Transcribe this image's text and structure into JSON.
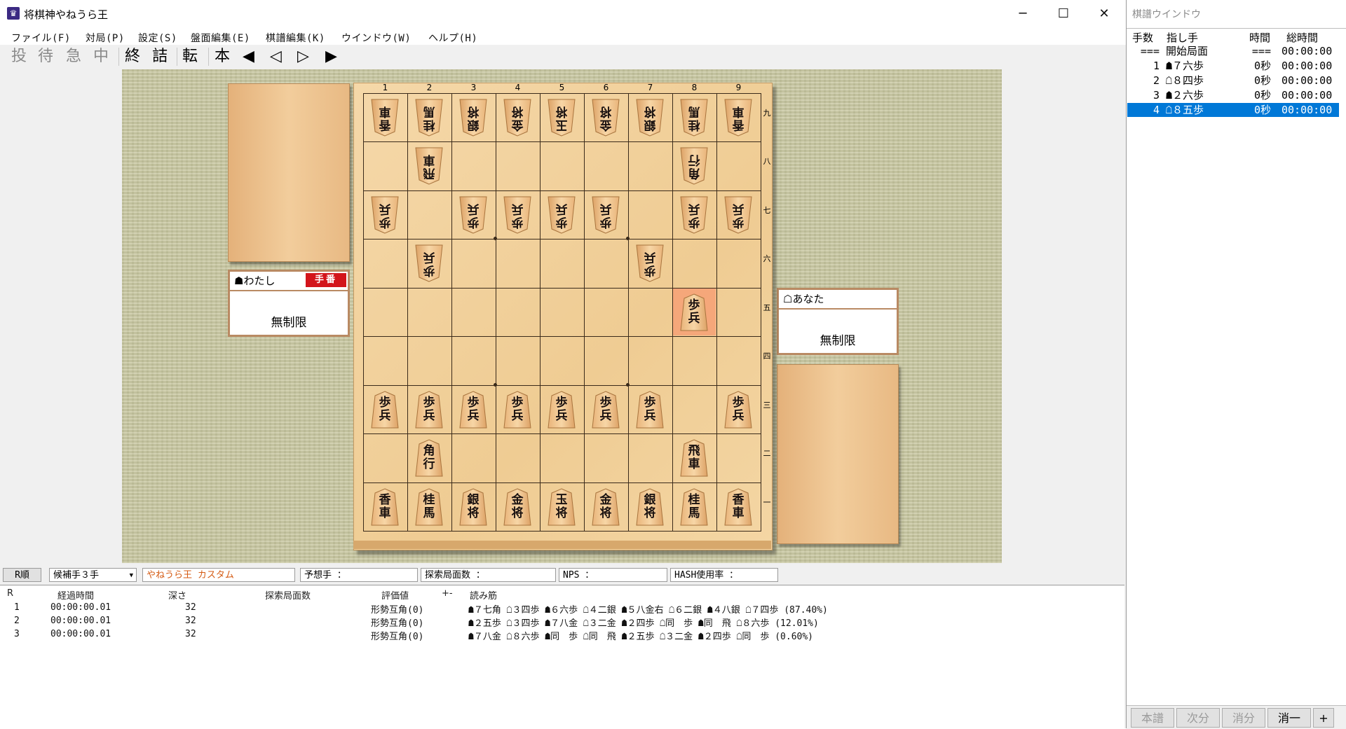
{
  "window": {
    "title": "将棋神やねうら王",
    "app_icon": "crown-icon",
    "minimize": "─",
    "maximize": "☐",
    "close": "✕"
  },
  "menu": [
    "ファイル(F)",
    "対局(P)",
    "設定(S)",
    "盤面編集(E)",
    "棋譜編集(K)",
    "ウインドウ(W)",
    "ヘルプ(H)"
  ],
  "toolbar": {
    "disabled": [
      "投",
      "待",
      "急",
      "中"
    ],
    "enabled_a": [
      "終",
      "詰"
    ],
    "flip": "転",
    "main": "本",
    "first": "◀",
    "prev": "◁",
    "next": "▷",
    "last": "▶"
  },
  "players": {
    "sente": {
      "name": "☗わたし",
      "time": "無制限",
      "turn_badge": "手番"
    },
    "gote": {
      "name": "☖あなた",
      "time": "無制限"
    }
  },
  "board": {
    "file_labels": [
      "1",
      "2",
      "3",
      "4",
      "5",
      "6",
      "7",
      "8",
      "9"
    ],
    "rank_labels": [
      "九",
      "八",
      "七",
      "六",
      "五",
      "四",
      "三",
      "二",
      "一"
    ],
    "last_move_square": {
      "col": 8,
      "row": 5
    },
    "pieces": [
      {
        "col": 1,
        "row": 1,
        "label": "香車",
        "side": "gote"
      },
      {
        "col": 2,
        "row": 1,
        "label": "桂馬",
        "side": "gote"
      },
      {
        "col": 3,
        "row": 1,
        "label": "銀将",
        "side": "gote"
      },
      {
        "col": 4,
        "row": 1,
        "label": "金将",
        "side": "gote"
      },
      {
        "col": 5,
        "row": 1,
        "label": "玉将",
        "side": "gote"
      },
      {
        "col": 6,
        "row": 1,
        "label": "金将",
        "side": "gote"
      },
      {
        "col": 7,
        "row": 1,
        "label": "銀将",
        "side": "gote"
      },
      {
        "col": 8,
        "row": 1,
        "label": "桂馬",
        "side": "gote"
      },
      {
        "col": 9,
        "row": 1,
        "label": "香車",
        "side": "gote"
      },
      {
        "col": 2,
        "row": 2,
        "label": "飛車",
        "side": "gote"
      },
      {
        "col": 8,
        "row": 2,
        "label": "角行",
        "side": "gote"
      },
      {
        "col": 1,
        "row": 3,
        "label": "歩兵",
        "side": "gote"
      },
      {
        "col": 3,
        "row": 3,
        "label": "歩兵",
        "side": "gote"
      },
      {
        "col": 4,
        "row": 3,
        "label": "歩兵",
        "side": "gote"
      },
      {
        "col": 5,
        "row": 3,
        "label": "歩兵",
        "side": "gote"
      },
      {
        "col": 6,
        "row": 3,
        "label": "歩兵",
        "side": "gote"
      },
      {
        "col": 8,
        "row": 3,
        "label": "歩兵",
        "side": "gote"
      },
      {
        "col": 9,
        "row": 3,
        "label": "歩兵",
        "side": "gote"
      },
      {
        "col": 2,
        "row": 4,
        "label": "歩兵",
        "side": "gote"
      },
      {
        "col": 7,
        "row": 4,
        "label": "歩兵",
        "side": "gote"
      },
      {
        "col": 8,
        "row": 5,
        "label": "歩兵",
        "side": "sente"
      },
      {
        "col": 1,
        "row": 7,
        "label": "歩兵",
        "side": "sente"
      },
      {
        "col": 2,
        "row": 7,
        "label": "歩兵",
        "side": "sente"
      },
      {
        "col": 3,
        "row": 7,
        "label": "歩兵",
        "side": "sente"
      },
      {
        "col": 4,
        "row": 7,
        "label": "歩兵",
        "side": "sente"
      },
      {
        "col": 5,
        "row": 7,
        "label": "歩兵",
        "side": "sente"
      },
      {
        "col": 6,
        "row": 7,
        "label": "歩兵",
        "side": "sente"
      },
      {
        "col": 7,
        "row": 7,
        "label": "歩兵",
        "side": "sente"
      },
      {
        "col": 9,
        "row": 7,
        "label": "歩兵",
        "side": "sente"
      },
      {
        "col": 2,
        "row": 8,
        "label": "角行",
        "side": "sente"
      },
      {
        "col": 8,
        "row": 8,
        "label": "飛車",
        "side": "sente"
      },
      {
        "col": 1,
        "row": 9,
        "label": "香車",
        "side": "sente"
      },
      {
        "col": 2,
        "row": 9,
        "label": "桂馬",
        "side": "sente"
      },
      {
        "col": 3,
        "row": 9,
        "label": "銀将",
        "side": "sente"
      },
      {
        "col": 4,
        "row": 9,
        "label": "金将",
        "side": "sente"
      },
      {
        "col": 5,
        "row": 9,
        "label": "玉将",
        "side": "sente"
      },
      {
        "col": 6,
        "row": 9,
        "label": "金将",
        "side": "sente"
      },
      {
        "col": 7,
        "row": 9,
        "label": "銀将",
        "side": "sente"
      },
      {
        "col": 8,
        "row": 9,
        "label": "桂馬",
        "side": "sente"
      },
      {
        "col": 9,
        "row": 9,
        "label": "香車",
        "side": "sente"
      }
    ]
  },
  "engine": {
    "r_button": "R順",
    "candidates": "候補手３手",
    "engine_name": "やねうら王 カスタム",
    "predicted": "予想手 ：",
    "nodes": "探索局面数 ：",
    "nps": "NPS ：",
    "hash": "HASH使用率 ：",
    "columns": [
      "R",
      "経過時間",
      "深さ",
      "探索局面数",
      "評価値",
      "+-",
      "読み筋"
    ],
    "rows": [
      {
        "rank": "1",
        "time": "00:00:00.01",
        "depth": "32",
        "nodes": "",
        "eval": "形勢互角(0)",
        "pv": "☗７七角 ☖３四歩 ☗６六歩 ☖４二銀 ☗５八金右 ☖６二銀 ☗４八銀 ☖７四歩 (87.40%)"
      },
      {
        "rank": "2",
        "time": "00:00:00.01",
        "depth": "32",
        "nodes": "",
        "eval": "形勢互角(0)",
        "pv": "☗２五歩 ☖３四歩 ☗７八金 ☖３二金 ☗２四歩 ☖同　歩 ☗同　飛 ☖８六歩 (12.01%)"
      },
      {
        "rank": "3",
        "time": "00:00:00.01",
        "depth": "32",
        "nodes": "",
        "eval": "形勢互角(0)",
        "pv": "☗７八金 ☖８六歩 ☗同　歩 ☖同　飛 ☗２五歩 ☖３二金 ☗２四歩 ☖同　歩 (0.60%)"
      }
    ]
  },
  "kifu": {
    "title": "棋譜ウインドウ",
    "headers": [
      "手数",
      "指し手",
      "時間",
      "総時間"
    ],
    "rows": [
      {
        "num": "===",
        "move": "開始局面",
        "time": "===",
        "total": "00:00:00",
        "selected": false
      },
      {
        "num": "1",
        "move": "☗７六歩",
        "time": "0秒",
        "total": "00:00:00",
        "selected": false
      },
      {
        "num": "2",
        "move": "☖８四歩",
        "time": "0秒",
        "total": "00:00:00",
        "selected": false
      },
      {
        "num": "3",
        "move": "☗２六歩",
        "time": "0秒",
        "total": "00:00:00",
        "selected": false
      },
      {
        "num": "4",
        "move": "☖８五歩",
        "time": "0秒",
        "total": "00:00:00",
        "selected": true
      }
    ],
    "buttons": [
      {
        "label": "本譜",
        "enabled": false
      },
      {
        "label": "次分",
        "enabled": false
      },
      {
        "label": "消分",
        "enabled": false
      },
      {
        "label": "消一",
        "enabled": true
      },
      {
        "label": "+",
        "enabled": true
      }
    ]
  }
}
